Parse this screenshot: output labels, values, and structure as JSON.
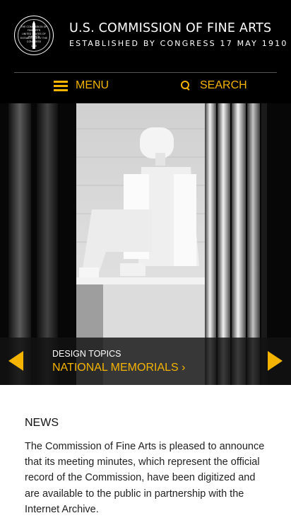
{
  "header": {
    "title": "U.S. COMMISSION OF FINE ARTS",
    "subtitle": "ESTABLISHED BY CONGRESS 17 MAY 1910",
    "seal": {
      "lines": [
        "THE COMMISSION OF",
        "FINE ARTS",
        "UNITED STATES OF AMERICA",
        "ESTABLISHED BY THE",
        "CONGRESS",
        "1910"
      ]
    }
  },
  "nav": {
    "menu_label": "MENU",
    "search_label": "SEARCH",
    "menu_icon": "hamburger-icon",
    "search_icon": "magnifier-icon"
  },
  "hero": {
    "image": "lincoln-memorial-statue-photo",
    "kicker": "DESIGN TOPICS",
    "title": "NATIONAL MEMORIALS ›",
    "prev_icon": "arrow-left-icon",
    "next_icon": "arrow-right-icon"
  },
  "news": {
    "heading": "NEWS",
    "body": "The Commission of Fine Arts is pleased to announce that its meeting minutes, which represent the official record of the Commission, have been digitized and are available to the public in partnership with the Internet Archive."
  },
  "colors": {
    "accent": "#f5b400",
    "header_bg": "#000000",
    "page_bg": "#ffffff"
  }
}
